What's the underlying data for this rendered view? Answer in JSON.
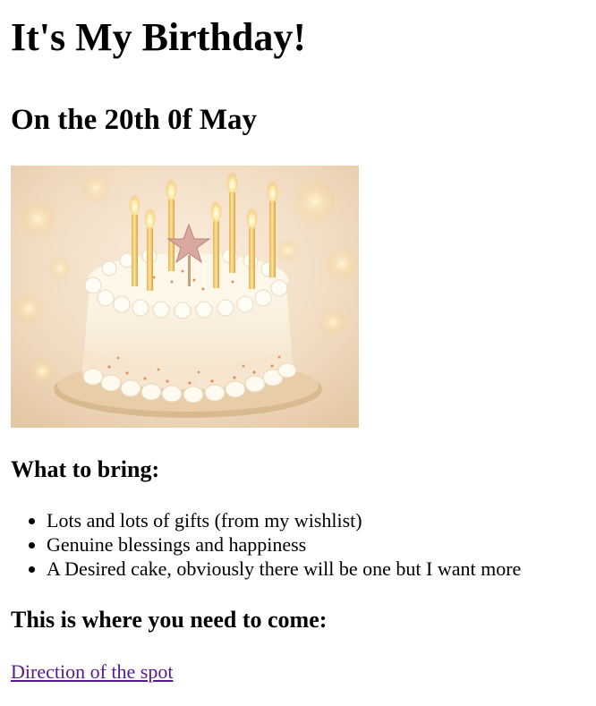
{
  "title": "It's My Birthday!",
  "date_heading": "On the 20th 0f May",
  "image": {
    "alt": "Birthday cake with candles",
    "icon": "birthday-cake-photo"
  },
  "bring": {
    "heading": "What to bring:",
    "items": [
      "Lots and lots of gifts (from my wishlist)",
      "Genuine blessings and happiness",
      "A Desired cake, obviously there will be one but I want more"
    ]
  },
  "location": {
    "heading": "This is where you need to come:",
    "link_text": "Direction of the spot",
    "link_color": "#551a8b"
  }
}
